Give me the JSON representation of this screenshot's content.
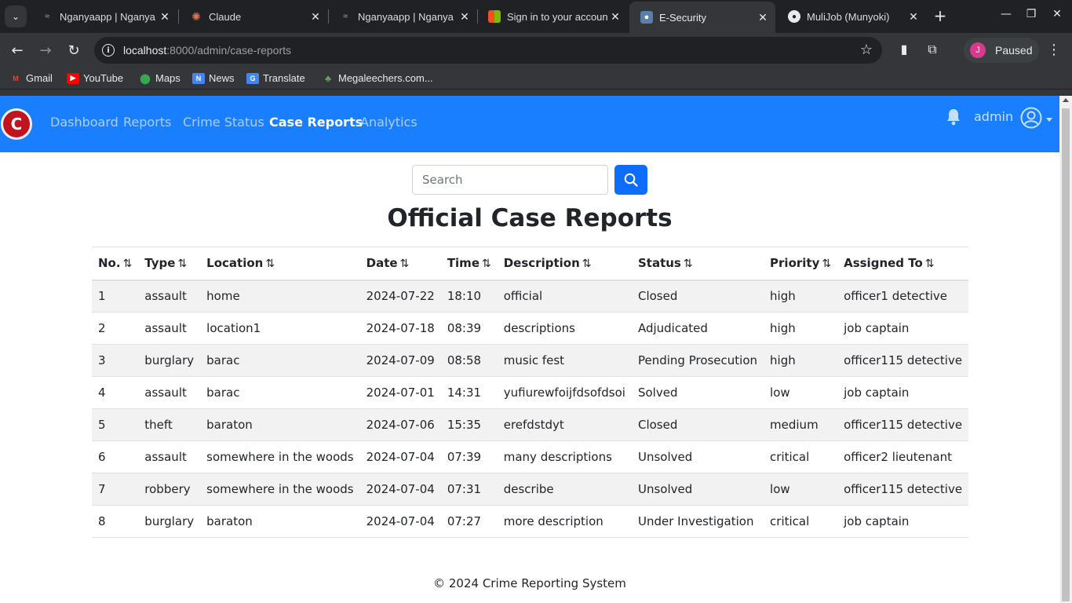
{
  "browser": {
    "tabs": [
      {
        "title": "Nganyaapp | Nganya",
        "active": false
      },
      {
        "title": "Claude",
        "active": false
      },
      {
        "title": "Nganyaapp | Nganya",
        "active": false
      },
      {
        "title": "Sign in to your account",
        "active": false
      },
      {
        "title": "E-Security",
        "active": true
      },
      {
        "title": "MuliJob (Munyoki)",
        "active": false
      }
    ],
    "url_host": "localhost",
    "url_rest": ":8000/admin/case-reports",
    "profile_initial": "J",
    "profile_label": "Paused",
    "bookmarks": [
      "Gmail",
      "YouTube",
      "Maps",
      "News",
      "Translate",
      "Megaleechers.com..."
    ]
  },
  "app": {
    "logo_letter": "C",
    "nav": [
      "Dashboard",
      "Reports",
      "Crime Status",
      "Case Reports",
      "Analytics"
    ],
    "active_nav": "Case Reports",
    "user_name": "admin",
    "accent": "#1a7fff"
  },
  "search": {
    "placeholder": "Search",
    "value": ""
  },
  "page_title": "Official Case Reports",
  "table": {
    "sort_glyph": "⇅",
    "columns": [
      "No.",
      "Type",
      "Location",
      "Date",
      "Time",
      "Description",
      "Status",
      "Priority",
      "Assigned To"
    ],
    "rows": [
      [
        "1",
        "assault",
        "home",
        "2024-07-22",
        "18:10",
        "official",
        "Closed",
        "high",
        "officer1 detective"
      ],
      [
        "2",
        "assault",
        "location1",
        "2024-07-18",
        "08:39",
        "descriptions",
        "Adjudicated",
        "high",
        "job captain"
      ],
      [
        "3",
        "burglary",
        "barac",
        "2024-07-09",
        "08:58",
        "music fest",
        "Pending Prosecution",
        "high",
        "officer115 detective"
      ],
      [
        "4",
        "assault",
        "barac",
        "2024-07-01",
        "14:31",
        "yufiurewfoijfdsofdsoi",
        "Solved",
        "low",
        "job captain"
      ],
      [
        "5",
        "theft",
        "baraton",
        "2024-07-06",
        "15:35",
        "erefdstdyt",
        "Closed",
        "medium",
        "officer115 detective"
      ],
      [
        "6",
        "assault",
        "somewhere in the woods",
        "2024-07-04",
        "07:39",
        "many descriptions",
        "Unsolved",
        "critical",
        "officer2 lieutenant"
      ],
      [
        "7",
        "robbery",
        "somewhere in the woods",
        "2024-07-04",
        "07:31",
        "describe",
        "Unsolved",
        "low",
        "officer115 detective"
      ],
      [
        "8",
        "burglary",
        "baraton",
        "2024-07-04",
        "07:27",
        "more description",
        "Under Investigation",
        "critical",
        "job captain"
      ]
    ]
  },
  "footer": "© 2024 Crime Reporting System"
}
